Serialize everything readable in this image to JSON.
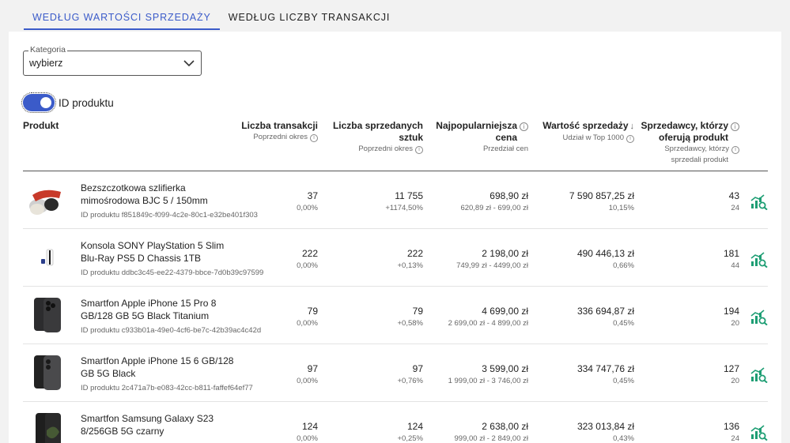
{
  "tabs": [
    {
      "label": "Według wartości sprzedaży",
      "active": true
    },
    {
      "label": "Według liczby transakcji",
      "active": false
    }
  ],
  "category": {
    "label": "Kategoria",
    "value": "wybierz"
  },
  "toggle": {
    "label": "ID produktu",
    "on": true
  },
  "columns": {
    "product": "Produkt",
    "transactions": {
      "title": "Liczba transakcji",
      "sub": "Poprzedni okres"
    },
    "units": {
      "title_line1": "Liczba sprzedanych",
      "title_line2": "sztuk",
      "sub": "Poprzedni okres"
    },
    "price": {
      "title_line1": "Najpopularniejsza",
      "title_line2": "cena",
      "sub": "Przedział cen"
    },
    "sales": {
      "title": "Wartość sprzedaży",
      "sort": "↓",
      "sub": "Udział w Top 1000"
    },
    "sellers": {
      "title_line1": "Sprzedawcy, którzy",
      "title_line2": "oferują produkt",
      "sub_line1": "Sprzedawcy, którzy",
      "sub_line2": "sprzedali produkt"
    }
  },
  "accent_color": "#3b5bc9",
  "icon_color": "#1e9e74",
  "rows": [
    {
      "name": "Bezszczotkowa szlifierka mimośrodowa BJC 5 / 150mm",
      "id": "ID produktu f851849c-f099-4c2e-80c1-e32be401f303",
      "transactions": "37",
      "transactions_prev": "0,00%",
      "units": "11 755",
      "units_prev": "+1174,50%",
      "price": "698,90 zł",
      "price_range": "620,89 zł - 699,00 zł",
      "sales": "7 590 857,25 zł",
      "share": "10,15%",
      "sellers_offer": "43",
      "sellers_sold": "24",
      "thumb": "sander"
    },
    {
      "name": "Konsola SONY PlayStation 5 Slim Blu-Ray PS5 D Chassis 1TB",
      "id": "ID produktu ddbc3c45-ee22-4379-bbce-7d0b39c97599",
      "transactions": "222",
      "transactions_prev": "0,00%",
      "units": "222",
      "units_prev": "+0,13%",
      "price": "2 198,00 zł",
      "price_range": "749,99 zł - 4499,00 zł",
      "sales": "490 446,13 zł",
      "share": "0,66%",
      "sellers_offer": "181",
      "sellers_sold": "44",
      "thumb": "console"
    },
    {
      "name": "Smartfon Apple iPhone 15 Pro 8 GB/128 GB 5G Black Titanium",
      "id": "ID produktu c933b01a-49e0-4cf6-be7c-42b39ac4c42d",
      "transactions": "79",
      "transactions_prev": "0,00%",
      "units": "79",
      "units_prev": "+0,58%",
      "price": "4 699,00 zł",
      "price_range": "2 699,00 zł - 4 899,00 zł",
      "sales": "336 694,87 zł",
      "share": "0,45%",
      "sellers_offer": "194",
      "sellers_sold": "20",
      "thumb": "iphone-pro"
    },
    {
      "name": "Smartfon Apple iPhone 15 6 GB/128 GB 5G Black",
      "id": "ID produktu 2c471a7b-e083-42cc-b811-faffef64ef77",
      "transactions": "97",
      "transactions_prev": "0,00%",
      "units": "97",
      "units_prev": "+0,76%",
      "price": "3 599,00 zł",
      "price_range": "1 999,00 zł - 3 746,00 zł",
      "sales": "334 747,76 zł",
      "share": "0,45%",
      "sellers_offer": "127",
      "sellers_sold": "20",
      "thumb": "iphone"
    },
    {
      "name": "Smartfon Samsung Galaxy S23 8/256GB 5G czarny",
      "id": "",
      "transactions": "124",
      "transactions_prev": "0,00%",
      "units": "124",
      "units_prev": "+0,25%",
      "price": "2 638,00 zł",
      "price_range": "999,00 zł - 2 849,00 zł",
      "sales": "323 013,84 zł",
      "share": "0,43%",
      "sellers_offer": "136",
      "sellers_sold": "24",
      "thumb": "samsung"
    }
  ]
}
